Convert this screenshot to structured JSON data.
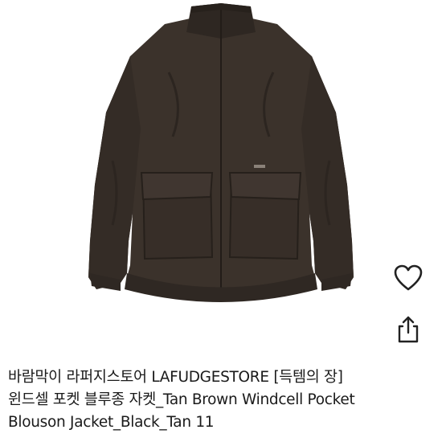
{
  "product": {
    "image_alt": "",
    "title_lines": [
      "바람막이 라퍼지스토어 LAFUDGESTORE [득템의 장]",
      "윈드셀 포켓 블루종 자켓_Tan Brown Windcell Pocket",
      "Blouson Jacket_Black_Tan 11"
    ],
    "jacket_color": "#3b322b"
  },
  "actions": {
    "like_icon": "heart-outline-icon",
    "share_icon": "share-upload-icon"
  }
}
